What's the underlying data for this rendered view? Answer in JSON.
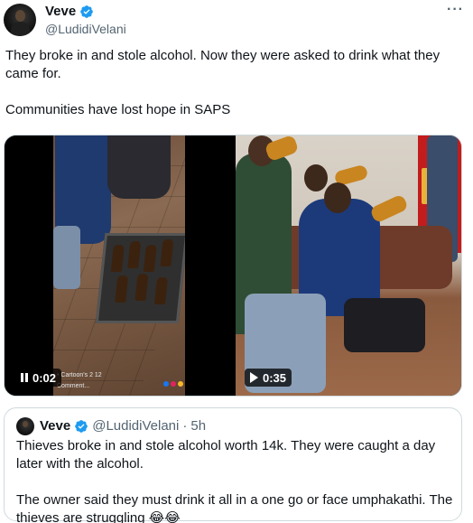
{
  "tweet": {
    "author": {
      "display_name": "Veve",
      "handle": "@LudidiVelani",
      "verified": true,
      "verified_color": "#1d9bf0"
    },
    "more_label": "···",
    "text_line1": "They broke in and stole alcohol. Now they were asked to drink what they came for.",
    "text_line2": "Communities have lost hope in SAPS",
    "media": [
      {
        "kind": "video",
        "state": "paused",
        "timestamp": "0:02",
        "overlay_caption": "• Cartoon's 2 12",
        "overlay_comment": "Comment..."
      },
      {
        "kind": "video",
        "state": "play",
        "timestamp": "0:35"
      }
    ]
  },
  "quoted_tweet": {
    "display_name": "Veve",
    "handle": "@LudidiVelani",
    "separator": "·",
    "time": "5h",
    "verified": true,
    "text_para1": "Thieves broke in and stole alcohol worth 14k. They were caught a day later with the alcohol.",
    "text_para2": "The owner said they must drink it all in a one go or face umphakathi. The thieves are struggling 😂😂"
  },
  "colors": {
    "text_primary": "#0f1419",
    "text_secondary": "#536471",
    "border": "#cfd9de",
    "accent": "#1d9bf0"
  }
}
